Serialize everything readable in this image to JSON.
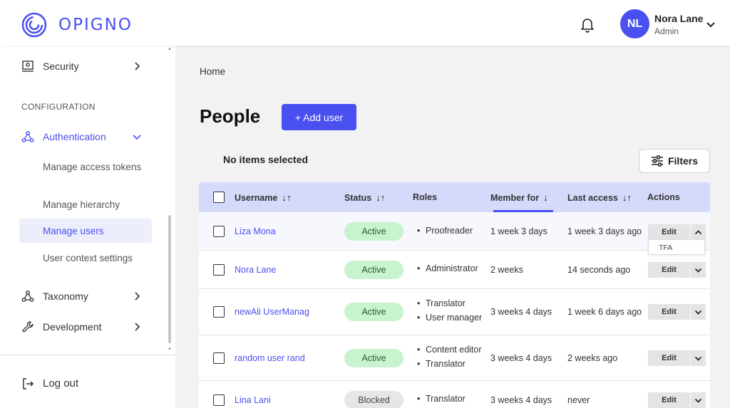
{
  "header": {
    "logo_text": "OPIGNO",
    "user_initials": "NL",
    "user_name": "Nora Lane",
    "user_role": "Admin",
    "accent_color": "#4a4ff0"
  },
  "sidebar": {
    "security_label": "Security",
    "section_label": "CONFIGURATION",
    "authentication_label": "Authentication",
    "sub_items": [
      {
        "label": "Manage access tokens"
      },
      {
        "label": "Manage hierarchy"
      },
      {
        "label": "Manage users"
      },
      {
        "label": "User context settings"
      }
    ],
    "taxonomy_label": "Taxonomy",
    "development_label": "Development",
    "logout_label": "Log out"
  },
  "main": {
    "breadcrumb": "Home",
    "title": "People",
    "add_button": "+ Add user",
    "selection_status": "No items selected",
    "filters_button": "Filters"
  },
  "table": {
    "headers": {
      "username": "Username",
      "status": "Status",
      "roles": "Roles",
      "member_for": "Member for",
      "last_access": "Last access",
      "actions": "Actions"
    },
    "sort_icons": {
      "both": "↓↑",
      "down": "↓"
    },
    "rows": [
      {
        "username": "Liza Mona",
        "status": "Active",
        "roles": [
          "Proofreader"
        ],
        "member_for": "1 week 3 days",
        "last_access": "1 week 3 days ago",
        "action": "Edit"
      },
      {
        "username": "Nora Lane",
        "status": "Active",
        "roles": [
          "Administrator"
        ],
        "member_for": "2 weeks",
        "last_access": "14 seconds ago",
        "action": "Edit"
      },
      {
        "username": "newAli UserManag",
        "status": "Active",
        "roles": [
          "Translator",
          "User manager"
        ],
        "member_for": "3 weeks 4 days",
        "last_access": "1 week 6 days ago",
        "action": "Edit"
      },
      {
        "username": "random user rand",
        "status": "Active",
        "roles": [
          "Content editor",
          "Translator"
        ],
        "member_for": "3 weeks 4 days",
        "last_access": "2 weeks ago",
        "action": "Edit"
      },
      {
        "username": "Lina Lani",
        "status": "Blocked",
        "roles": [
          "Translator"
        ],
        "member_for": "3 weeks 4 days",
        "last_access": "never",
        "action": "Edit"
      }
    ],
    "dropdown_option": "TFA"
  }
}
